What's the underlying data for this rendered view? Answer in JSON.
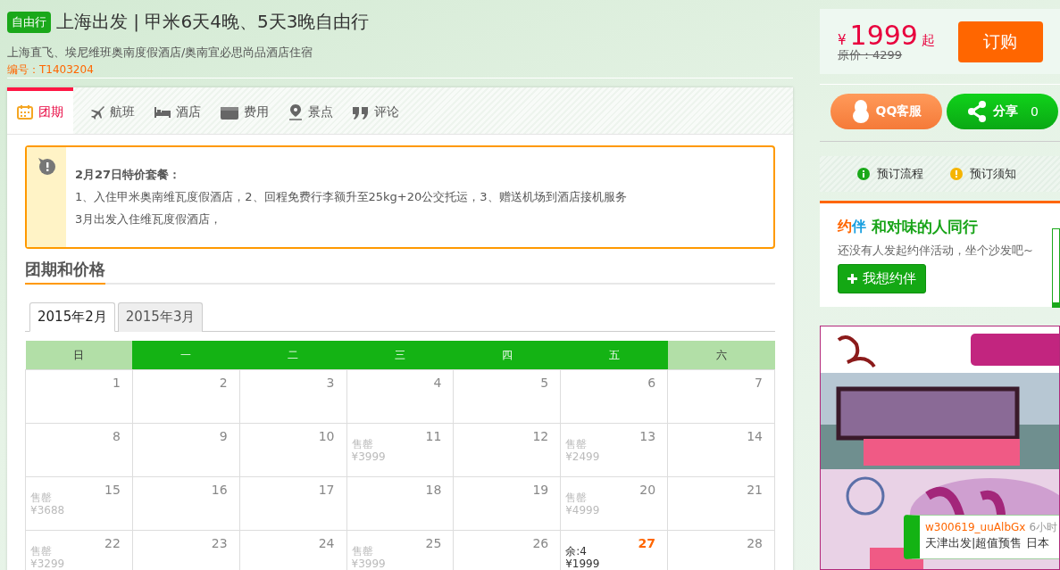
{
  "header": {
    "badge": "自由行",
    "title": "上海出发 | 甲米6天4晚、5天3晚自由行",
    "subtitle": "上海直飞、埃尼维班奥南度假酒店/奥南宜必思尚品酒店住宿",
    "code": "编号：T1403204"
  },
  "tabs": [
    {
      "label": "团期",
      "kind": "dates",
      "selected": true
    },
    {
      "label": "航班",
      "kind": "flights",
      "selected": false
    },
    {
      "label": "酒店",
      "kind": "hotels",
      "selected": false
    },
    {
      "label": "费用",
      "kind": "costs",
      "selected": false
    },
    {
      "label": "景点",
      "kind": "sights",
      "selected": false
    },
    {
      "label": "评论",
      "kind": "reviews",
      "selected": false
    }
  ],
  "notice": {
    "title": "2月27日特价套餐：",
    "lines": [
      "1、入住甲米奥南维瓦度假酒店，2、回程免费行李额升至25kg+20公交托运，3、赠送机场到酒店接机服务",
      "3月出发入住维瓦度假酒店，"
    ]
  },
  "section_title": "团期和价格",
  "month_tabs": [
    {
      "label": "2015年2月",
      "selected": true
    },
    {
      "label": "2015年3月",
      "selected": false
    }
  ],
  "calendar": {
    "weekdays": [
      {
        "label": "日",
        "weekend": true
      },
      {
        "label": "一",
        "weekend": false
      },
      {
        "label": "二",
        "weekend": false
      },
      {
        "label": "三",
        "weekend": false
      },
      {
        "label": "四",
        "weekend": false
      },
      {
        "label": "五",
        "weekend": false
      },
      {
        "label": "六",
        "weekend": true
      }
    ],
    "weeks": [
      [
        {
          "day": "1",
          "kind": "plain"
        },
        {
          "day": "2",
          "kind": "plain"
        },
        {
          "day": "3",
          "kind": "plain"
        },
        {
          "day": "4",
          "kind": "plain"
        },
        {
          "day": "5",
          "kind": "plain"
        },
        {
          "day": "6",
          "kind": "plain"
        },
        {
          "day": "7",
          "kind": "plain"
        }
      ],
      [
        {
          "day": "8",
          "kind": "plain"
        },
        {
          "day": "9",
          "kind": "plain"
        },
        {
          "day": "10",
          "kind": "plain"
        },
        {
          "day": "11",
          "kind": "soldout",
          "note": "售罄",
          "price": "¥3999"
        },
        {
          "day": "12",
          "kind": "plain"
        },
        {
          "day": "13",
          "kind": "soldout",
          "note": "售罄",
          "price": "¥2499"
        },
        {
          "day": "14",
          "kind": "plain"
        }
      ],
      [
        {
          "day": "15",
          "kind": "soldout",
          "note": "售罄",
          "price": "¥3688"
        },
        {
          "day": "16",
          "kind": "plain"
        },
        {
          "day": "17",
          "kind": "plain"
        },
        {
          "day": "18",
          "kind": "plain"
        },
        {
          "day": "19",
          "kind": "plain"
        },
        {
          "day": "20",
          "kind": "soldout",
          "note": "售罄",
          "price": "¥4999"
        },
        {
          "day": "21",
          "kind": "plain"
        }
      ],
      [
        {
          "day": "22",
          "kind": "soldout",
          "note": "售罄",
          "price": "¥3299"
        },
        {
          "day": "23",
          "kind": "plain"
        },
        {
          "day": "24",
          "kind": "plain"
        },
        {
          "day": "25",
          "kind": "soldout",
          "note": "售罄",
          "price": "¥3999"
        },
        {
          "day": "26",
          "kind": "plain"
        },
        {
          "day": "27",
          "kind": "available",
          "note": "余:4",
          "price": "¥1999"
        },
        {
          "day": "28",
          "kind": "plain"
        }
      ]
    ]
  },
  "price_card": {
    "currency": "¥",
    "price": "1999",
    "suffix": "起",
    "original": "原价：4299",
    "buy_button": "订购"
  },
  "service_buttons": {
    "qq": "QQ客服",
    "share": "分享",
    "share_count": "0"
  },
  "info_links": [
    {
      "label": "预订流程",
      "kind": "info"
    },
    {
      "label": "预订须知",
      "kind": "warning"
    }
  ],
  "companion": {
    "logo_left": "约",
    "logo_right": "伴",
    "title": "和对味的人同行",
    "text": "还没有人发起约伴活动，坐个沙发吧~",
    "button": "我想约伴"
  },
  "popup": {
    "user": "w300619_uuAlbGx",
    "time": "6小时",
    "text": "天津出发|超值预售 日本"
  }
}
